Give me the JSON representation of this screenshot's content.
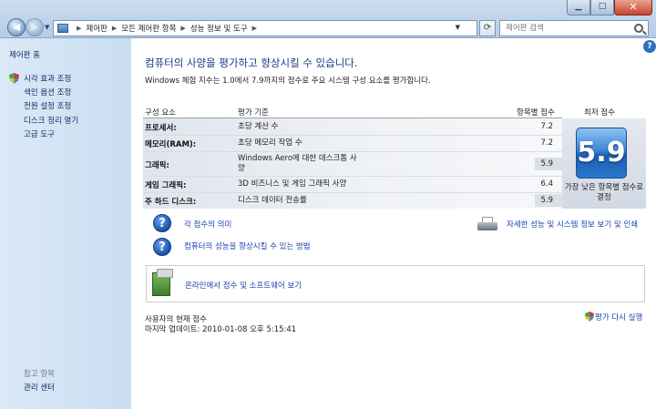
{
  "address": {
    "crumbs": [
      "제어판",
      "모든 제어판 항목",
      "성능 정보 및 도구"
    ],
    "search_placeholder": "제어판 검색"
  },
  "sidebar": {
    "home": "제어판 홈",
    "items": [
      {
        "label": "시각 효과 조정",
        "shield": true
      },
      {
        "label": "색인 옵션 조정",
        "shield": false
      },
      {
        "label": "전원 설정 조정",
        "shield": false
      },
      {
        "label": "디스크 정리 열기",
        "shield": false
      },
      {
        "label": "고급 도구",
        "shield": false
      }
    ],
    "see_also_title": "참고 항목",
    "see_also_items": [
      "관리 센터"
    ]
  },
  "main": {
    "title": "컴퓨터의 사양을 평가하고 향상시킬 수 있습니다.",
    "description": "Windows 체험 지수는 1.0에서 7.9까지의 점수로 주요 시스템 구성 요소를 평가합니다.",
    "table": {
      "headers": {
        "component": "구성 요소",
        "rating": "평가 기준",
        "subscore": "항목별 점수",
        "basescore": "최저 점수"
      },
      "rows": [
        {
          "component": "프로세서:",
          "rating": "초당 계산 수",
          "score": "7.2"
        },
        {
          "component": "메모리(RAM):",
          "rating": "초당 메모리 작업 수",
          "score": "7.2"
        },
        {
          "component": "그래픽:",
          "rating": "Windows Aero에 대한 데스크톱 사양",
          "score": "5.9"
        },
        {
          "component": "게임 그래픽:",
          "rating": "3D 비즈니스 및 게임 그래픽 사양",
          "score": "6.4"
        },
        {
          "component": "주 하드 디스크:",
          "rating": "디스크 데이터 전송률",
          "score": "5.9"
        }
      ],
      "base_score": "5.9",
      "base_caption": "가장 낮은 항목별 점수로 결정"
    },
    "links": {
      "meaning": "각 점수의 의미",
      "improve": "컴퓨터의 성능을 향상시킬 수 있는 방법",
      "details": "자세한 성능 및 시스템 정보 보기 및 인쇄",
      "online": "온라인에서 점수 및 소프트웨어 보기"
    },
    "status": {
      "user_score": "사용자의 현재 점수",
      "last_update": "마지막 업데이트: 2010-01-08 오후 5:15:41",
      "rerun": "평가 다시 실행"
    }
  }
}
